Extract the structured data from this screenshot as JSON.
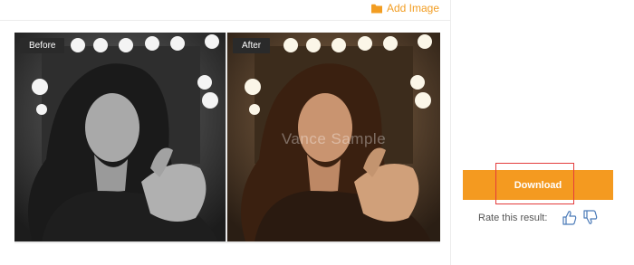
{
  "header": {
    "add_image_label": "Add Image",
    "add_image_icon": "folder-icon",
    "accent_color": "#f29d22"
  },
  "comparison": {
    "before_label": "Before",
    "after_label": "After",
    "watermark_text": "Vance Sample"
  },
  "sidebar": {
    "download_label": "Download",
    "download_color": "#f49a20",
    "rate_label": "Rate this result:",
    "thumbs_up_icon": "thumbs-up-icon",
    "thumbs_down_icon": "thumbs-down-icon",
    "highlight_color": "#e43c3c"
  }
}
